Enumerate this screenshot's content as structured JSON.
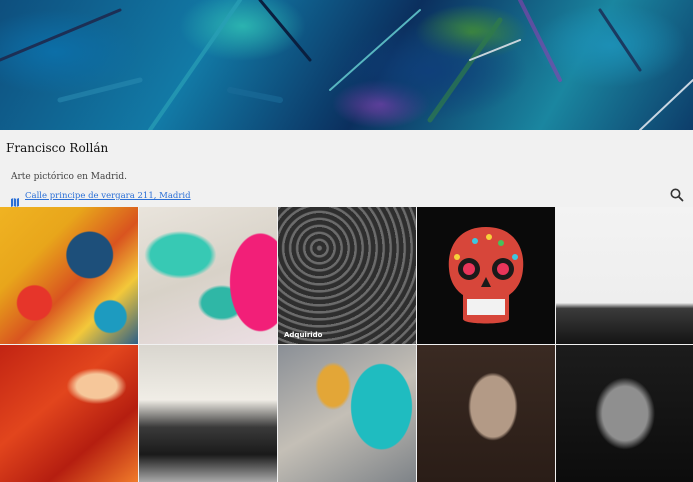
{
  "profile": {
    "name": "Francisco Rollán",
    "description": "Arte pictórico en Madrid.",
    "location": "Calle principe de vergara 211, Madrid"
  },
  "icons": {
    "location": "map-icon",
    "search": "search-icon"
  },
  "colors": {
    "link": "#2a6fd6",
    "background": "#f1f1f1"
  },
  "gallery": [
    {
      "id": 1,
      "badge": ""
    },
    {
      "id": 2,
      "badge": ""
    },
    {
      "id": 3,
      "badge": "Adquirido"
    },
    {
      "id": 4,
      "badge": ""
    },
    {
      "id": 5,
      "badge": ""
    },
    {
      "id": 6,
      "badge": ""
    },
    {
      "id": 7,
      "badge": ""
    },
    {
      "id": 8,
      "badge": ""
    },
    {
      "id": 9,
      "badge": ""
    },
    {
      "id": 10,
      "badge": ""
    }
  ]
}
